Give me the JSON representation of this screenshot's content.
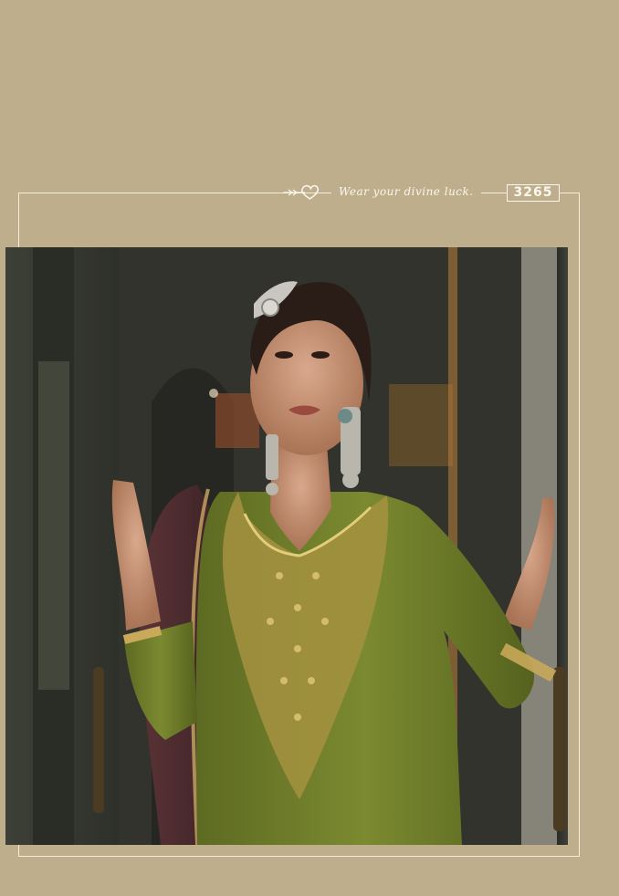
{
  "header": {
    "tagline": "Wear your divine luck.",
    "code": "3265"
  },
  "colors": {
    "background": "#bfae8b",
    "frame": "#f3ede0",
    "outfit_green": "#6f7a2a",
    "embroidery_gold": "#c9a95a",
    "dupatta_maroon": "#4a2a2e"
  },
  "icons": {
    "header_ornament": "arrow-heart-icon"
  }
}
